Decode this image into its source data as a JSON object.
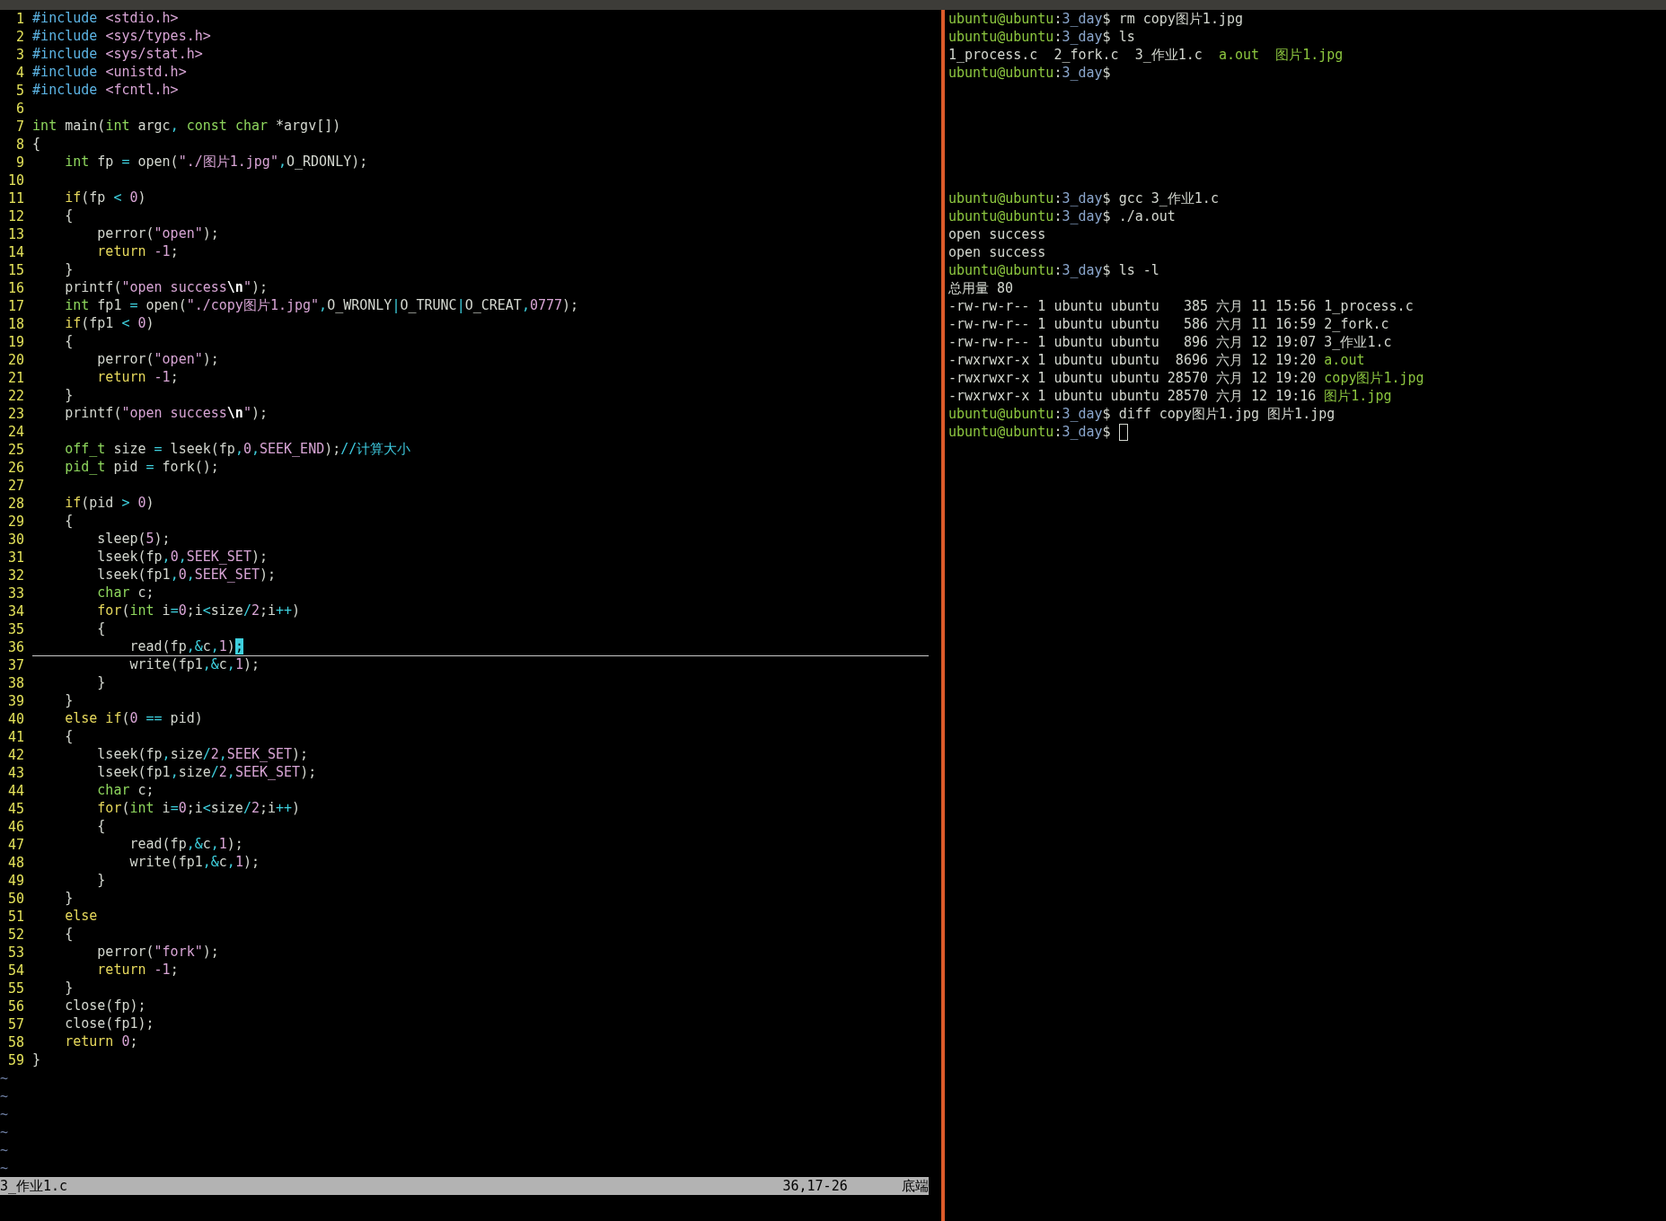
{
  "editor": {
    "lines": [
      {
        "number": "1",
        "current": false,
        "segments": [
          {
            "kind": "preproc",
            "text": "#include "
          },
          {
            "kind": "string",
            "text": "<stdio.h>"
          }
        ]
      },
      {
        "number": "2",
        "current": false,
        "segments": [
          {
            "kind": "preproc",
            "text": "#include "
          },
          {
            "kind": "string",
            "text": "<sys/types.h>"
          }
        ]
      },
      {
        "number": "3",
        "current": false,
        "segments": [
          {
            "kind": "preproc",
            "text": "#include "
          },
          {
            "kind": "string",
            "text": "<sys/stat.h>"
          }
        ]
      },
      {
        "number": "4",
        "current": false,
        "segments": [
          {
            "kind": "preproc",
            "text": "#include "
          },
          {
            "kind": "string",
            "text": "<unistd.h>"
          }
        ]
      },
      {
        "number": "5",
        "current": false,
        "segments": [
          {
            "kind": "preproc",
            "text": "#include "
          },
          {
            "kind": "string",
            "text": "<fcntl.h>"
          }
        ]
      },
      {
        "number": "6",
        "current": false
      },
      {
        "number": "7",
        "current": false,
        "segments": [
          {
            "kind": "type",
            "text": "int"
          },
          {
            "kind": "plain",
            "text": " main("
          },
          {
            "kind": "type",
            "text": "int"
          },
          {
            "kind": "plain",
            "text": " argc"
          },
          {
            "kind": "operator",
            "text": ", "
          },
          {
            "kind": "type",
            "text": "const "
          },
          {
            "kind": "type",
            "text": "char"
          },
          {
            "kind": "plain",
            "text": " *argv[])"
          }
        ]
      },
      {
        "number": "8",
        "current": false,
        "segments": [
          {
            "kind": "plain",
            "text": "{"
          }
        ]
      },
      {
        "number": "9",
        "current": false,
        "segments": [
          {
            "kind": "type",
            "text": "    int"
          },
          {
            "kind": "plain",
            "text": " fp "
          },
          {
            "kind": "operator",
            "text": "="
          },
          {
            "kind": "plain",
            "text": " open("
          },
          {
            "kind": "string",
            "text": "\"./图片1.jpg\""
          },
          {
            "kind": "operator",
            "text": ","
          },
          {
            "kind": "plain",
            "text": "O_RDONLY);"
          }
        ]
      },
      {
        "number": "10",
        "current": false
      },
      {
        "number": "11",
        "current": false,
        "segments": [
          {
            "kind": "statement",
            "text": "    if"
          },
          {
            "kind": "plain",
            "text": "(fp "
          },
          {
            "kind": "operator",
            "text": "<"
          },
          {
            "kind": "number",
            "text": " 0"
          },
          {
            "kind": "plain",
            "text": ")"
          }
        ]
      },
      {
        "number": "12",
        "current": false,
        "segments": [
          {
            "kind": "plain",
            "text": "    {"
          }
        ]
      },
      {
        "number": "13",
        "current": false,
        "segments": [
          {
            "kind": "plain",
            "text": "        perror("
          },
          {
            "kind": "string",
            "text": "\"open\""
          },
          {
            "kind": "plain",
            "text": ");"
          }
        ]
      },
      {
        "number": "14",
        "current": false,
        "segments": [
          {
            "kind": "statement",
            "text": "        return"
          },
          {
            "kind": "number",
            "text": " -1"
          },
          {
            "kind": "plain",
            "text": ";"
          }
        ]
      },
      {
        "number": "15",
        "current": false,
        "segments": [
          {
            "kind": "plain",
            "text": "    }"
          }
        ]
      },
      {
        "number": "16",
        "current": false,
        "segments": [
          {
            "kind": "plain",
            "text": "    printf("
          },
          {
            "kind": "string",
            "text": "\"open success"
          },
          {
            "kind": "special",
            "text": "\\n"
          },
          {
            "kind": "string",
            "text": "\""
          },
          {
            "kind": "plain",
            "text": ");"
          }
        ]
      },
      {
        "number": "17",
        "current": false,
        "segments": [
          {
            "kind": "type",
            "text": "    int"
          },
          {
            "kind": "plain",
            "text": " fp1 "
          },
          {
            "kind": "operator",
            "text": "="
          },
          {
            "kind": "plain",
            "text": " open("
          },
          {
            "kind": "string",
            "text": "\"./copy图片1.jpg\""
          },
          {
            "kind": "operator",
            "text": ","
          },
          {
            "kind": "plain",
            "text": "O_WRONLY"
          },
          {
            "kind": "operator",
            "text": "|"
          },
          {
            "kind": "plain",
            "text": "O_TRUNC"
          },
          {
            "kind": "operator",
            "text": "|"
          },
          {
            "kind": "plain",
            "text": "O_CREAT"
          },
          {
            "kind": "operator",
            "text": ","
          },
          {
            "kind": "number",
            "text": "0777"
          },
          {
            "kind": "plain",
            "text": ");"
          }
        ]
      },
      {
        "number": "18",
        "current": false,
        "segments": [
          {
            "kind": "statement",
            "text": "    if"
          },
          {
            "kind": "plain",
            "text": "(fp1 "
          },
          {
            "kind": "operator",
            "text": "<"
          },
          {
            "kind": "number",
            "text": " 0"
          },
          {
            "kind": "plain",
            "text": ")"
          }
        ]
      },
      {
        "number": "19",
        "current": false,
        "segments": [
          {
            "kind": "plain",
            "text": "    {"
          }
        ]
      },
      {
        "number": "20",
        "current": false,
        "segments": [
          {
            "kind": "plain",
            "text": "        perror("
          },
          {
            "kind": "string",
            "text": "\"open\""
          },
          {
            "kind": "plain",
            "text": ");"
          }
        ]
      },
      {
        "number": "21",
        "current": false,
        "segments": [
          {
            "kind": "statement",
            "text": "        return"
          },
          {
            "kind": "number",
            "text": " -1"
          },
          {
            "kind": "plain",
            "text": ";"
          }
        ]
      },
      {
        "number": "22",
        "current": false,
        "segments": [
          {
            "kind": "plain",
            "text": "    }"
          }
        ]
      },
      {
        "number": "23",
        "current": false,
        "segments": [
          {
            "kind": "plain",
            "text": "    printf("
          },
          {
            "kind": "string",
            "text": "\"open success"
          },
          {
            "kind": "special",
            "text": "\\n"
          },
          {
            "kind": "string",
            "text": "\""
          },
          {
            "kind": "plain",
            "text": ");"
          }
        ]
      },
      {
        "number": "24",
        "current": false
      },
      {
        "number": "25",
        "current": false,
        "segments": [
          {
            "kind": "type",
            "text": "    off_t"
          },
          {
            "kind": "plain",
            "text": " size "
          },
          {
            "kind": "operator",
            "text": "="
          },
          {
            "kind": "plain",
            "text": " lseek(fp"
          },
          {
            "kind": "operator",
            "text": ","
          },
          {
            "kind": "number",
            "text": "0"
          },
          {
            "kind": "operator",
            "text": ","
          },
          {
            "kind": "constant",
            "text": "SEEK_END"
          },
          {
            "kind": "plain",
            "text": ");"
          },
          {
            "kind": "comment",
            "text": "//计算大小"
          }
        ]
      },
      {
        "number": "26",
        "current": false,
        "segments": [
          {
            "kind": "type",
            "text": "    pid_t"
          },
          {
            "kind": "plain",
            "text": " pid "
          },
          {
            "kind": "operator",
            "text": "="
          },
          {
            "kind": "plain",
            "text": " fork();"
          }
        ]
      },
      {
        "number": "27",
        "current": false
      },
      {
        "number": "28",
        "current": false,
        "segments": [
          {
            "kind": "statement",
            "text": "    if"
          },
          {
            "kind": "plain",
            "text": "(pid "
          },
          {
            "kind": "operator",
            "text": ">"
          },
          {
            "kind": "number",
            "text": " 0"
          },
          {
            "kind": "plain",
            "text": ")"
          }
        ]
      },
      {
        "number": "29",
        "current": false,
        "segments": [
          {
            "kind": "plain",
            "text": "    {"
          }
        ]
      },
      {
        "number": "30",
        "current": false,
        "segments": [
          {
            "kind": "plain",
            "text": "        sleep("
          },
          {
            "kind": "number",
            "text": "5"
          },
          {
            "kind": "plain",
            "text": ");"
          }
        ]
      },
      {
        "number": "31",
        "current": false,
        "segments": [
          {
            "kind": "plain",
            "text": "        lseek(fp"
          },
          {
            "kind": "operator",
            "text": ","
          },
          {
            "kind": "number",
            "text": "0"
          },
          {
            "kind": "operator",
            "text": ","
          },
          {
            "kind": "constant",
            "text": "SEEK_SET"
          },
          {
            "kind": "plain",
            "text": ");"
          }
        ]
      },
      {
        "number": "32",
        "current": false,
        "segments": [
          {
            "kind": "plain",
            "text": "        lseek(fp1"
          },
          {
            "kind": "operator",
            "text": ","
          },
          {
            "kind": "number",
            "text": "0"
          },
          {
            "kind": "operator",
            "text": ","
          },
          {
            "kind": "constant",
            "text": "SEEK_SET"
          },
          {
            "kind": "plain",
            "text": ");"
          }
        ]
      },
      {
        "number": "33",
        "current": false,
        "segments": [
          {
            "kind": "type",
            "text": "        char"
          },
          {
            "kind": "plain",
            "text": " c;"
          }
        ]
      },
      {
        "number": "34",
        "current": false,
        "segments": [
          {
            "kind": "statement",
            "text": "        for"
          },
          {
            "kind": "plain",
            "text": "("
          },
          {
            "kind": "type",
            "text": "int"
          },
          {
            "kind": "plain",
            "text": " i"
          },
          {
            "kind": "operator",
            "text": "="
          },
          {
            "kind": "number",
            "text": "0"
          },
          {
            "kind": "plain",
            "text": ";i"
          },
          {
            "kind": "operator",
            "text": "<"
          },
          {
            "kind": "plain",
            "text": "size"
          },
          {
            "kind": "operator",
            "text": "/"
          },
          {
            "kind": "number",
            "text": "2"
          },
          {
            "kind": "plain",
            "text": ";i"
          },
          {
            "kind": "operator",
            "text": "++"
          },
          {
            "kind": "plain",
            "text": ")"
          }
        ]
      },
      {
        "number": "35",
        "current": false,
        "segments": [
          {
            "kind": "plain",
            "text": "        {"
          }
        ]
      },
      {
        "number": "36",
        "current": true,
        "segments": [
          {
            "kind": "plain",
            "text": "            read(fp"
          },
          {
            "kind": "operator",
            "text": ",&"
          },
          {
            "kind": "plain",
            "text": "c"
          },
          {
            "kind": "operator",
            "text": ","
          },
          {
            "kind": "number",
            "text": "1"
          },
          {
            "kind": "plain",
            "text": ")"
          },
          {
            "kind": "cursor",
            "text": ";"
          }
        ]
      },
      {
        "number": "37",
        "current": false,
        "segments": [
          {
            "kind": "plain",
            "text": "            write(fp1"
          },
          {
            "kind": "operator",
            "text": ",&"
          },
          {
            "kind": "plain",
            "text": "c"
          },
          {
            "kind": "operator",
            "text": ","
          },
          {
            "kind": "number",
            "text": "1"
          },
          {
            "kind": "plain",
            "text": ");"
          }
        ]
      },
      {
        "number": "38",
        "current": false,
        "segments": [
          {
            "kind": "plain",
            "text": "        }"
          }
        ]
      },
      {
        "number": "39",
        "current": false,
        "segments": [
          {
            "kind": "plain",
            "text": "    }"
          }
        ]
      },
      {
        "number": "40",
        "current": false,
        "segments": [
          {
            "kind": "statement",
            "text": "    else if"
          },
          {
            "kind": "plain",
            "text": "("
          },
          {
            "kind": "number",
            "text": "0"
          },
          {
            "kind": "operator",
            "text": " =="
          },
          {
            "kind": "plain",
            "text": " pid)"
          }
        ]
      },
      {
        "number": "41",
        "current": false,
        "segments": [
          {
            "kind": "plain",
            "text": "    {"
          }
        ]
      },
      {
        "number": "42",
        "current": false,
        "segments": [
          {
            "kind": "plain",
            "text": "        lseek(fp"
          },
          {
            "kind": "operator",
            "text": ","
          },
          {
            "kind": "plain",
            "text": "size"
          },
          {
            "kind": "operator",
            "text": "/"
          },
          {
            "kind": "number",
            "text": "2"
          },
          {
            "kind": "operator",
            "text": ","
          },
          {
            "kind": "constant",
            "text": "SEEK_SET"
          },
          {
            "kind": "plain",
            "text": ");"
          }
        ]
      },
      {
        "number": "43",
        "current": false,
        "segments": [
          {
            "kind": "plain",
            "text": "        lseek(fp1"
          },
          {
            "kind": "operator",
            "text": ","
          },
          {
            "kind": "plain",
            "text": "size"
          },
          {
            "kind": "operator",
            "text": "/"
          },
          {
            "kind": "number",
            "text": "2"
          },
          {
            "kind": "operator",
            "text": ","
          },
          {
            "kind": "constant",
            "text": "SEEK_SET"
          },
          {
            "kind": "plain",
            "text": ");"
          }
        ]
      },
      {
        "number": "44",
        "current": false,
        "segments": [
          {
            "kind": "type",
            "text": "        char"
          },
          {
            "kind": "plain",
            "text": " c;"
          }
        ]
      },
      {
        "number": "45",
        "current": false,
        "segments": [
          {
            "kind": "statement",
            "text": "        for"
          },
          {
            "kind": "plain",
            "text": "("
          },
          {
            "kind": "type",
            "text": "int"
          },
          {
            "kind": "plain",
            "text": " i"
          },
          {
            "kind": "operator",
            "text": "="
          },
          {
            "kind": "number",
            "text": "0"
          },
          {
            "kind": "plain",
            "text": ";i"
          },
          {
            "kind": "operator",
            "text": "<"
          },
          {
            "kind": "plain",
            "text": "size"
          },
          {
            "kind": "operator",
            "text": "/"
          },
          {
            "kind": "number",
            "text": "2"
          },
          {
            "kind": "plain",
            "text": ";i"
          },
          {
            "kind": "operator",
            "text": "++"
          },
          {
            "kind": "plain",
            "text": ")"
          }
        ]
      },
      {
        "number": "46",
        "current": false,
        "segments": [
          {
            "kind": "plain",
            "text": "        {"
          }
        ]
      },
      {
        "number": "47",
        "current": false,
        "segments": [
          {
            "kind": "plain",
            "text": "            read(fp"
          },
          {
            "kind": "operator",
            "text": ",&"
          },
          {
            "kind": "plain",
            "text": "c"
          },
          {
            "kind": "operator",
            "text": ","
          },
          {
            "kind": "number",
            "text": "1"
          },
          {
            "kind": "plain",
            "text": ");"
          }
        ]
      },
      {
        "number": "48",
        "current": false,
        "segments": [
          {
            "kind": "plain",
            "text": "            write(fp1"
          },
          {
            "kind": "operator",
            "text": ",&"
          },
          {
            "kind": "plain",
            "text": "c"
          },
          {
            "kind": "operator",
            "text": ","
          },
          {
            "kind": "number",
            "text": "1"
          },
          {
            "kind": "plain",
            "text": ");"
          }
        ]
      },
      {
        "number": "49",
        "current": false,
        "segments": [
          {
            "kind": "plain",
            "text": "        }"
          }
        ]
      },
      {
        "number": "50",
        "current": false,
        "segments": [
          {
            "kind": "plain",
            "text": "    }"
          }
        ]
      },
      {
        "number": "51",
        "current": false,
        "segments": [
          {
            "kind": "statement",
            "text": "    else"
          }
        ]
      },
      {
        "number": "52",
        "current": false,
        "segments": [
          {
            "kind": "plain",
            "text": "    {"
          }
        ]
      },
      {
        "number": "53",
        "current": false,
        "segments": [
          {
            "kind": "plain",
            "text": "        perror("
          },
          {
            "kind": "string",
            "text": "\"fork\""
          },
          {
            "kind": "plain",
            "text": ");"
          }
        ]
      },
      {
        "number": "54",
        "current": false,
        "segments": [
          {
            "kind": "statement",
            "text": "        return"
          },
          {
            "kind": "number",
            "text": " -1"
          },
          {
            "kind": "plain",
            "text": ";"
          }
        ]
      },
      {
        "number": "55",
        "current": false,
        "segments": [
          {
            "kind": "plain",
            "text": "    }"
          }
        ]
      },
      {
        "number": "56",
        "current": false,
        "segments": [
          {
            "kind": "plain",
            "text": "    close(fp);"
          }
        ]
      },
      {
        "number": "57",
        "current": false,
        "segments": [
          {
            "kind": "plain",
            "text": "    close(fp1);"
          }
        ]
      },
      {
        "number": "58",
        "current": false,
        "segments": [
          {
            "kind": "statement",
            "text": "    return"
          },
          {
            "kind": "number",
            "text": " 0"
          },
          {
            "kind": "plain",
            "text": ";"
          }
        ]
      },
      {
        "number": "59",
        "current": false,
        "segments": [
          {
            "kind": "plain",
            "text": "}"
          }
        ]
      }
    ],
    "filler_lines": [
      "~",
      "~",
      "~",
      "~",
      "~",
      "~"
    ],
    "status_bar": {
      "file": "3_作业1.c",
      "position": "36,17-26",
      "scroll": "底端"
    }
  },
  "terminal": {
    "sections": [
      {
        "lines": [
          {
            "segments": [
              {
                "kind": "user",
                "text": "ubuntu@ubuntu"
              },
              {
                "kind": "plain",
                "text": ":"
              },
              {
                "kind": "path",
                "text": "3_day"
              },
              {
                "kind": "plain",
                "text": "$ rm copy图片1.jpg"
              }
            ]
          },
          {
            "segments": [
              {
                "kind": "user",
                "text": "ubuntu@ubuntu"
              },
              {
                "kind": "plain",
                "text": ":"
              },
              {
                "kind": "path",
                "text": "3_day"
              },
              {
                "kind": "plain",
                "text": "$ ls"
              }
            ]
          },
          {
            "segments": [
              {
                "kind": "plain",
                "text": "1_process.c  2_fork.c  3_作业1.c  "
              },
              {
                "kind": "executable",
                "text": "a.out"
              },
              {
                "kind": "executable",
                "text": "  图片1.jpg"
              }
            ]
          },
          {
            "segments": [
              {
                "kind": "user",
                "text": "ubuntu@ubuntu"
              },
              {
                "kind": "plain",
                "text": ":"
              },
              {
                "kind": "path",
                "text": "3_day"
              },
              {
                "kind": "plain",
                "text": "$"
              }
            ]
          }
        ]
      },
      {
        "lines": [
          {
            "segments": [
              {
                "kind": "user",
                "text": "ubuntu@ubuntu"
              },
              {
                "kind": "plain",
                "text": ":"
              },
              {
                "kind": "path",
                "text": "3_day"
              },
              {
                "kind": "plain",
                "text": "$ gcc 3_作业1.c"
              }
            ]
          },
          {
            "segments": [
              {
                "kind": "user",
                "text": "ubuntu@ubuntu"
              },
              {
                "kind": "plain",
                "text": ":"
              },
              {
                "kind": "path",
                "text": "3_day"
              },
              {
                "kind": "plain",
                "text": "$ ./a.out"
              }
            ]
          },
          {
            "segments": [
              {
                "kind": "plain",
                "text": "open success"
              }
            ]
          },
          {
            "segments": [
              {
                "kind": "plain",
                "text": "open success"
              }
            ]
          },
          {
            "segments": [
              {
                "kind": "user",
                "text": "ubuntu@ubuntu"
              },
              {
                "kind": "plain",
                "text": ":"
              },
              {
                "kind": "path",
                "text": "3_day"
              },
              {
                "kind": "plain",
                "text": "$ ls -l"
              }
            ]
          },
          {
            "segments": [
              {
                "kind": "plain",
                "text": "总用量 80"
              }
            ]
          },
          {
            "segments": [
              {
                "kind": "plain",
                "text": "-rw-rw-r-- 1 ubuntu ubuntu   385 六月 11 15:56 1_process.c"
              }
            ]
          },
          {
            "segments": [
              {
                "kind": "plain",
                "text": "-rw-rw-r-- 1 ubuntu ubuntu   586 六月 11 16:59 2_fork.c"
              }
            ]
          },
          {
            "segments": [
              {
                "kind": "plain",
                "text": "-rw-rw-r-- 1 ubuntu ubuntu   896 六月 12 19:07 3_作业1.c"
              }
            ]
          },
          {
            "segments": [
              {
                "kind": "plain",
                "text": "-rwxrwxr-x 1 ubuntu ubuntu  8696 六月 12 19:20 "
              },
              {
                "kind": "executable",
                "text": "a.out"
              }
            ]
          },
          {
            "segments": [
              {
                "kind": "plain",
                "text": "-rwxrwxr-x 1 ubuntu ubuntu 28570 六月 12 19:20 "
              },
              {
                "kind": "executable",
                "text": "copy图片1.jpg"
              }
            ]
          },
          {
            "segments": [
              {
                "kind": "plain",
                "text": "-rwxrwxr-x 1 ubuntu ubuntu 28570 六月 12 19:16 "
              },
              {
                "kind": "executable",
                "text": "图片1.jpg"
              }
            ]
          },
          {
            "segments": [
              {
                "kind": "user",
                "text": "ubuntu@ubuntu"
              },
              {
                "kind": "plain",
                "text": ":"
              },
              {
                "kind": "path",
                "text": "3_day"
              },
              {
                "kind": "plain",
                "text": "$ diff copy图片1.jpg 图片1.jpg"
              }
            ]
          },
          {
            "segments": [
              {
                "kind": "user",
                "text": "ubuntu@ubuntu"
              },
              {
                "kind": "plain",
                "text": ":"
              },
              {
                "kind": "path",
                "text": "3_day"
              },
              {
                "kind": "plain",
                "text": "$ "
              },
              {
                "kind": "hollow_cursor"
              }
            ]
          }
        ]
      }
    ]
  }
}
